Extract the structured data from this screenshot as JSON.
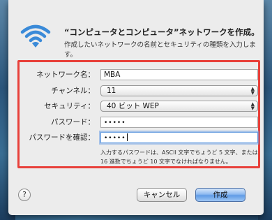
{
  "dialog": {
    "title": "“コンピュータとコンピュータ”ネットワークを作成。",
    "description": "作成したいネットワークの名前とセキュリティの種類を入力します。"
  },
  "form": {
    "network_name": {
      "label": "ネットワーク名：",
      "value": "MBA"
    },
    "channel": {
      "label": "チャンネル：",
      "value": "11"
    },
    "security": {
      "label": "セキュリティ：",
      "value": "40 ビット WEP"
    },
    "password": {
      "label": "パスワード：",
      "value": "•••••"
    },
    "confirm": {
      "label": "パスワードを確認：",
      "value": "•••••"
    },
    "hint_line1": "入力するパスワードは、ASCII 文字でちょうど 5 文字、または",
    "hint_line2": "16 進数でちょうど 10 文字でなければなりません。"
  },
  "buttons": {
    "help": "?",
    "cancel": "キャンセル",
    "create": "作成"
  },
  "colors": {
    "highlight_box": "#e8403a",
    "wifi_icon": "#3a8ad8",
    "default_button": "#5f9be6"
  },
  "icons": {
    "wifi": "wifi-icon",
    "popup_arrows": "up-down-arrows-icon"
  }
}
